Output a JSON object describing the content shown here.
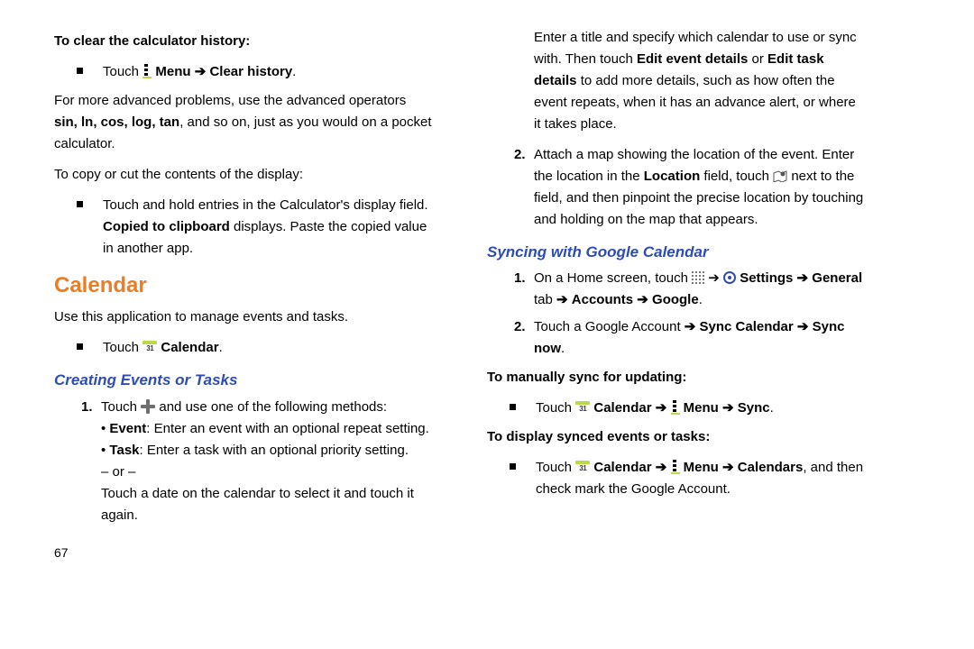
{
  "left": {
    "clearHeading": "To clear the calculator history:",
    "clearItem_touch": "Touch ",
    "clearItem_menuBold": "Menu",
    "clearItem_arrow": " ➔ ",
    "clearItem_clearBold": "Clear history",
    "clearItem_period": ".",
    "adv1": "For more advanced problems, use the advanced operators ",
    "adv_ops": "sin, ln, cos, log, tan",
    "adv2": ", and so on, just as you would on a pocket calculator.",
    "copyIntro": "To copy or cut the contents of the display:",
    "copyItem1": "Touch and hold entries in the Calculator's display field.",
    "copyItem2a": "Copied to clipboard",
    "copyItem2b": " displays. Paste the copied value in another app.",
    "calHeading": "Calendar",
    "calIntro": "Use this application to manage events and tasks.",
    "calTouch_touch": "Touch ",
    "calTouch_cal": "Calendar",
    "calTouch_period": ".",
    "creatingHeading": "Creating Events or Tasks",
    "n1_a": "Touch ",
    "n1_b": " and use one of the following methods:",
    "n1_eventBold": "Event",
    "n1_eventRest": ": Enter an event with an optional repeat setting.",
    "n1_taskBold": "Task",
    "n1_taskRest": ": Enter a task with an optional priority setting.",
    "n1_or": "– or –",
    "n1_alt": "Touch a date on the calendar to select it and touch it again.",
    "pageNum": "67"
  },
  "right": {
    "cont1a": "Enter a title and specify which calendar to use or sync with. Then touch ",
    "cont1_edit1": "Edit event details",
    "cont1_or": " or ",
    "cont1_edit2": "Edit task details",
    "cont1b": " to add more details, such as how often the event repeats, when it has an advance alert, or where it takes place.",
    "n2a": "Attach a map showing the location of the event. Enter the location in the ",
    "n2_loc": "Location",
    "n2b": " field, touch ",
    "n2c": " next to the field, and then pinpoint the precise location by touching and holding on the map that appears.",
    "syncHeading": "Syncing with Google Calendar",
    "s1_a": "On a Home screen, touch ",
    "s1_arrow": " ➔ ",
    "s1_settings": "Settings",
    "s1_general": "General",
    "s1_tab": " tab ",
    "s1_accounts": "Accounts",
    "s1_google": "Google",
    "s1_period": ".",
    "s2_a": "Touch a Google Account ",
    "s2_syncCal": "Sync Calendar",
    "s2_syncNow": "Sync now",
    "s2_period": ".",
    "manualHeading": "To manually sync for updating:",
    "m_touch": "Touch ",
    "m_cal": "Calendar",
    "m_menu": "Menu",
    "m_sync": "Sync",
    "m_period": ".",
    "displayHeading": "To display synced events or tasks:",
    "d_touch": "Touch ",
    "d_cal": "Calendar",
    "d_menu": "Menu",
    "d_calendars": "Calendars",
    "d_rest": ", and then check mark the Google Account."
  }
}
